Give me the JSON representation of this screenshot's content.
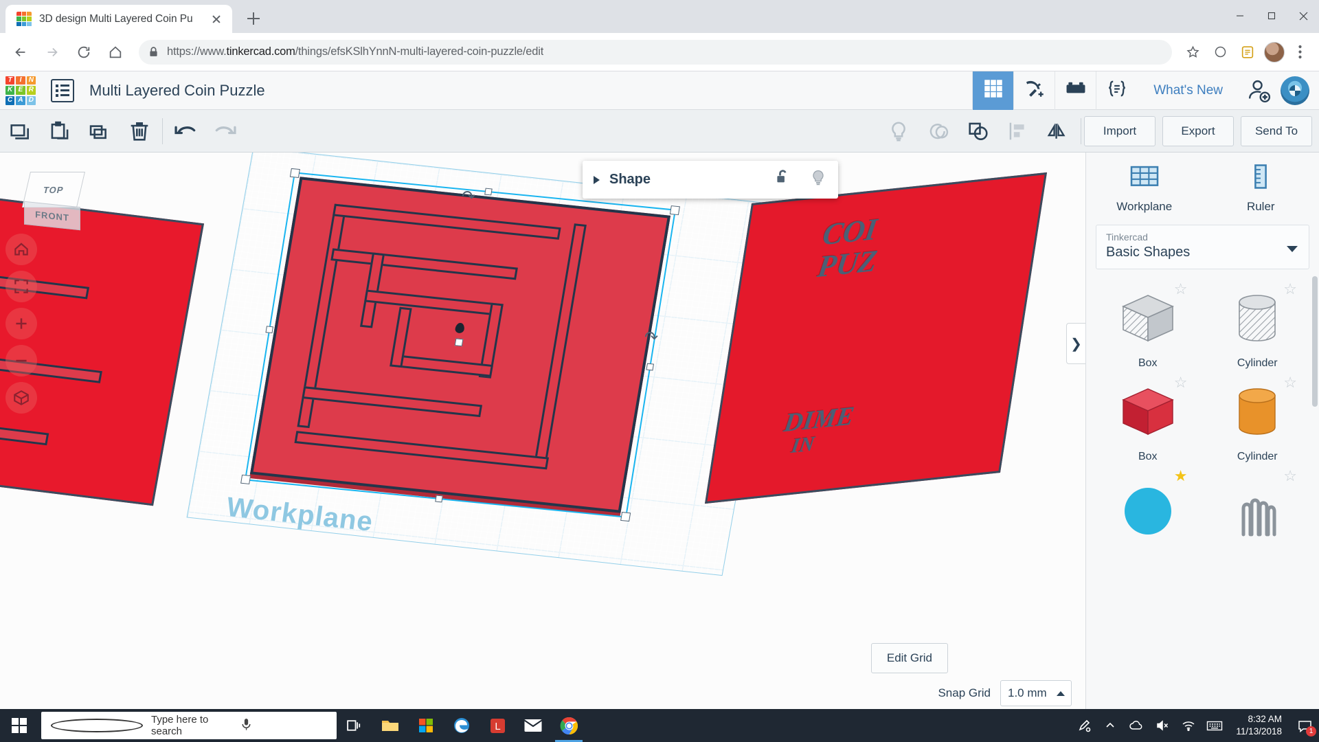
{
  "browser": {
    "tab": {
      "title": "3D design Multi Layered Coin Pu",
      "favicon_name": "tinkercad-favicon",
      "close_label": "×"
    },
    "new_tab_label": "+",
    "window": {
      "minimize": "–",
      "maximize": "□",
      "close": "×"
    },
    "nav": {
      "back": "back-arrow",
      "forward": "forward-arrow",
      "reload": "reload-icon",
      "home": "home-icon"
    },
    "url_scheme": "https://www.",
    "url_host": "tinkercad.com",
    "url_path": "/things/efsKSlhYnnN-multi-layered-coin-puzzle/edit",
    "url_full": "https://www.tinkercad.com/things/efsKSlhYnnN-multi-layered-coin-puzzle/edit",
    "toolbar_icons": [
      "star-icon",
      "extension-circle-icon",
      "shield-extension-icon",
      "menu-dots-icon"
    ]
  },
  "app": {
    "logo_tiles": [
      {
        "letter": "T",
        "color": "#f4442e"
      },
      {
        "letter": "I",
        "color": "#f4702e"
      },
      {
        "letter": "N",
        "color": "#f59a2e"
      },
      {
        "letter": "K",
        "color": "#3fb44b"
      },
      {
        "letter": "E",
        "color": "#7cc628"
      },
      {
        "letter": "R",
        "color": "#b8cf1e"
      },
      {
        "letter": "C",
        "color": "#0f6fb5"
      },
      {
        "letter": "A",
        "color": "#3c9bd6"
      },
      {
        "letter": "D",
        "color": "#7dc3e8"
      }
    ],
    "menu_icon": "hamburger-list-icon",
    "doc_title": "Multi Layered Coin Puzzle",
    "modes": [
      {
        "name": "grid-mode",
        "icon": "grid-icon",
        "active": true
      },
      {
        "name": "codeblocks-mode",
        "icon": "pickaxe-icon",
        "active": false
      },
      {
        "name": "bricks-mode",
        "icon": "lego-brick-icon",
        "active": false
      },
      {
        "name": "code-mode",
        "icon": "curly-braces-icon",
        "active": false
      }
    ],
    "whats_new": "What's New",
    "user_add_icon": "person-add-icon",
    "user_avatar": "user-avatar"
  },
  "toolbar": {
    "left_tools": [
      {
        "name": "copy-button",
        "icon": "copy-icon"
      },
      {
        "name": "paste-button",
        "icon": "paste-icon"
      },
      {
        "name": "duplicate-button",
        "icon": "duplicate-icon"
      },
      {
        "name": "delete-button",
        "icon": "trash-icon"
      }
    ],
    "history": [
      {
        "name": "undo-button",
        "icon": "undo-arrow-icon",
        "enabled": true
      },
      {
        "name": "redo-button",
        "icon": "redo-arrow-icon",
        "enabled": false
      }
    ],
    "object_tools": [
      {
        "name": "hide-button",
        "icon": "lightbulb-icon",
        "enabled": false
      },
      {
        "name": "ungroup-button",
        "icon": "ungroup-icon",
        "enabled": false
      },
      {
        "name": "group-button",
        "icon": "group-shapes-icon",
        "enabled": true
      },
      {
        "name": "align-button",
        "icon": "align-icon",
        "enabled": false
      },
      {
        "name": "mirror-button",
        "icon": "mirror-icon",
        "enabled": true
      }
    ],
    "import_label": "Import",
    "export_label": "Export",
    "send_to_label": "Send To"
  },
  "canvas": {
    "viewcube": {
      "top_face": "TOP",
      "front_face": "FRONT"
    },
    "nav_buttons": [
      {
        "name": "home-view-button",
        "icon": "home-icon"
      },
      {
        "name": "fit-view-button",
        "icon": "fit-all-icon"
      },
      {
        "name": "zoom-in-button",
        "icon": "plus-icon"
      },
      {
        "name": "zoom-out-button",
        "icon": "minus-icon"
      },
      {
        "name": "perspective-toggle-button",
        "icon": "cube-icon"
      }
    ],
    "workplane_label": "Workplane",
    "edit_grid_label": "Edit Grid",
    "snap_grid_label": "Snap Grid",
    "snap_grid_value": "1.0 mm",
    "panel_toggle_icon": "chevron-right-icon",
    "plate_color": "#dd3b4b",
    "plate_edge_color": "#24354a",
    "selection_color": "#19b5f0",
    "engraving_right": [
      "COI",
      "PUZ",
      "DIME",
      "IN"
    ]
  },
  "shape_popup": {
    "title": "Shape",
    "expand_icon": "triangle-right-icon",
    "lock_icon": "unlock-icon",
    "light_icon": "lightbulb-icon"
  },
  "sidebar": {
    "tools": [
      {
        "label": "Workplane",
        "icon": "workplane-grid-icon"
      },
      {
        "label": "Ruler",
        "icon": "ruler-icon"
      }
    ],
    "library_owner": "Tinkercad",
    "library_name": "Basic Shapes",
    "shapes": [
      {
        "name": "Box",
        "kind": "box-gray",
        "starred": false
      },
      {
        "name": "Cylinder",
        "kind": "cylinder-gray",
        "starred": false
      },
      {
        "name": "Box",
        "kind": "box-red",
        "starred": false
      },
      {
        "name": "Cylinder",
        "kind": "cylinder-orange",
        "starred": false
      },
      {
        "name": "",
        "kind": "sphere-blue",
        "starred": true
      },
      {
        "name": "",
        "kind": "scribble-gray",
        "starred": false
      }
    ]
  },
  "taskbar": {
    "start_icon": "windows-logo-icon",
    "search_placeholder": "Type here to search",
    "search_icon": "search-circle-icon",
    "mic_icon": "microphone-icon",
    "apps": [
      {
        "name": "task-view-button",
        "icon": "task-view-icon",
        "active": false
      },
      {
        "name": "file-explorer-button",
        "icon": "folder-icon",
        "active": false
      },
      {
        "name": "microsoft-store-button",
        "icon": "store-icon",
        "active": false
      },
      {
        "name": "edge-button",
        "icon": "edge-icon",
        "active": false
      },
      {
        "name": "lastpass-button",
        "icon": "lastpass-icon",
        "active": false
      },
      {
        "name": "mail-button",
        "icon": "mail-icon",
        "active": false
      },
      {
        "name": "chrome-button",
        "icon": "chrome-icon",
        "active": true
      }
    ],
    "tray": [
      {
        "name": "pen-menu-icon",
        "icon": "pen-icon"
      },
      {
        "name": "show-hidden-icons",
        "icon": "chevron-up-icon"
      },
      {
        "name": "onedrive-icon",
        "icon": "cloud-icon"
      },
      {
        "name": "volume-icon",
        "icon": "speaker-mute-icon"
      },
      {
        "name": "network-icon",
        "icon": "wifi-icon"
      },
      {
        "name": "keyboard-icon",
        "icon": "keyboard-icon"
      }
    ],
    "time": "8:32 AM",
    "date": "11/13/2018",
    "notification_count": "1"
  }
}
